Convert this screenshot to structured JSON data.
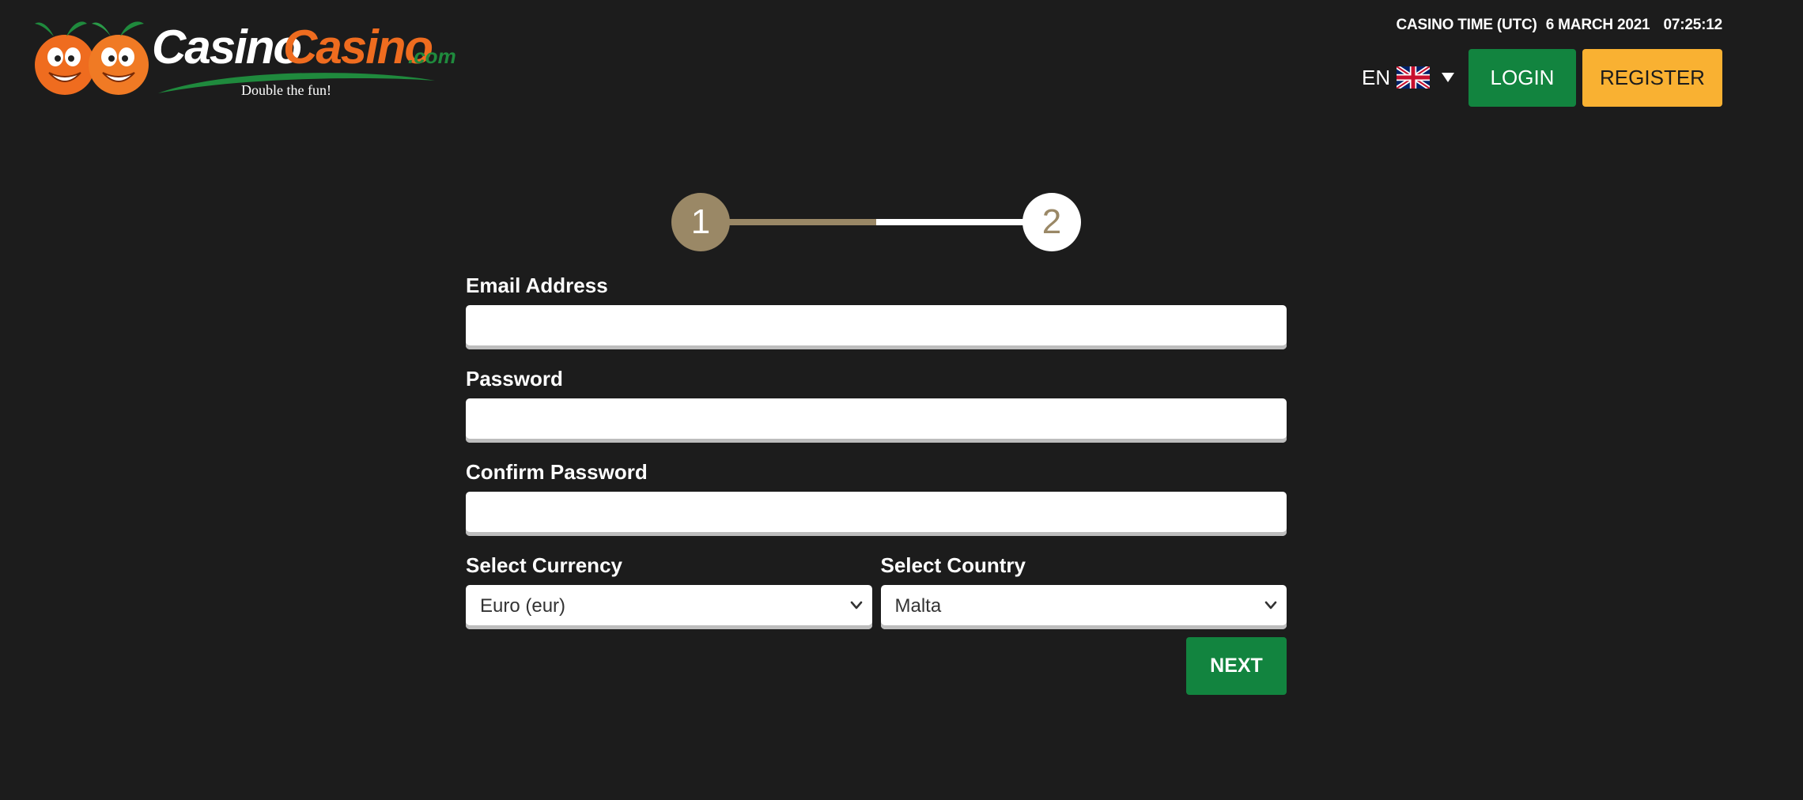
{
  "header": {
    "logo_text_primary": "Casino",
    "logo_text_secondary": "Casino",
    "logo_text_domain": ".com",
    "logo_tagline": "Double the fun!",
    "casino_time_label": "CASINO TIME (UTC)",
    "casino_time_date": "6 MARCH 2021",
    "casino_time_clock": "07:25:12",
    "language_code": "EN",
    "language_flag_icon": "uk-flag-icon",
    "login_label": "LOGIN",
    "register_label": "REGISTER"
  },
  "stepper": {
    "current_step": 1,
    "total_steps": 2,
    "steps": [
      {
        "label": "1",
        "state": "completed"
      },
      {
        "label": "2",
        "state": "upcoming"
      }
    ]
  },
  "form": {
    "email_label": "Email Address",
    "email_value": "",
    "password_label": "Password",
    "password_value": "",
    "confirm_password_label": "Confirm Password",
    "confirm_password_value": "",
    "currency_label": "Select Currency",
    "currency_value": "Euro (eur)",
    "country_label": "Select Country",
    "country_value": "Malta",
    "next_label": "NEXT"
  },
  "colors": {
    "background": "#1c1c1c",
    "primary_green": "#12843f",
    "register_yellow": "#f9b132",
    "step_gold": "#9a8866",
    "logo_orange": "#ef6c1f",
    "logo_green": "#1f8a3d"
  }
}
